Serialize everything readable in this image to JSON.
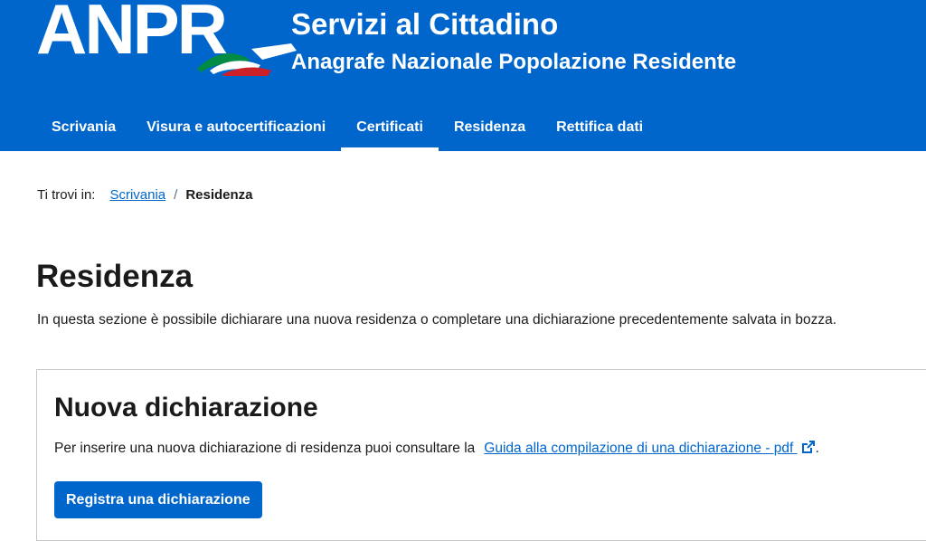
{
  "header": {
    "logo_text": "ANPR",
    "title": "Servizi al Cittadino",
    "subtitle": "Anagrafe Nazionale Popolazione Residente",
    "flag_colors": [
      "#008c45",
      "#ffffff",
      "#cd212a"
    ]
  },
  "nav": {
    "items": [
      {
        "label": "Scrivania",
        "active": false
      },
      {
        "label": "Visura e autocertificazioni",
        "active": false
      },
      {
        "label": "Certificati",
        "active": true
      },
      {
        "label": "Residenza",
        "active": false
      },
      {
        "label": "Rettifica dati",
        "active": false
      }
    ]
  },
  "breadcrumb": {
    "prefix": "Ti trovi in:",
    "link": "Scrivania",
    "separator": "/",
    "current": "Residenza"
  },
  "page": {
    "title": "Residenza",
    "description": "In questa sezione è possibile dichiarare una nuova residenza o completare una dichiarazione precedentemente salvata in bozza."
  },
  "card": {
    "title": "Nuova dichiarazione",
    "text": "Per inserire una nuova dichiarazione di residenza puoi consultare la",
    "link": "Guida alla compilazione di una dichiarazione - pdf",
    "link_icon": "external-link-icon",
    "after_link": ".",
    "button": "Registra una dichiarazione"
  },
  "colors": {
    "brand_blue": "#0066cc",
    "text": "#1a1a1a"
  }
}
